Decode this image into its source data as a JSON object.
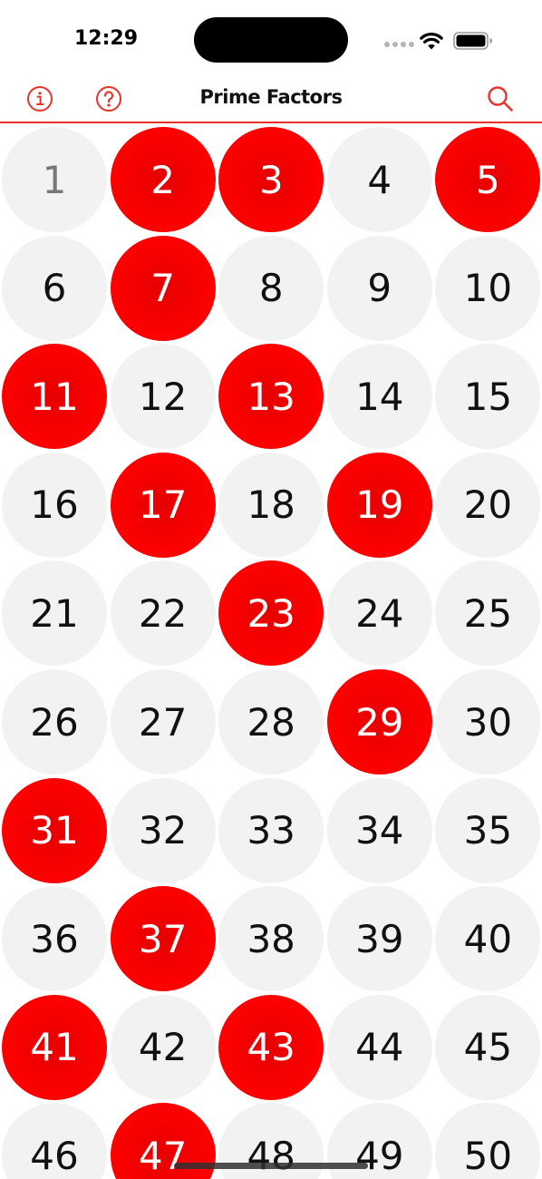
{
  "status_bar": {
    "time": "12:29"
  },
  "nav": {
    "title": "Prime Factors",
    "left_icons": [
      "info-icon",
      "help-icon"
    ],
    "right_icon": "search-icon"
  },
  "colors": {
    "accent": "#e8332a",
    "prime": "#ff0000",
    "composite_bg": "#f2f2f2",
    "unit_text": "#777777"
  },
  "grid": {
    "columns": 5,
    "cells": [
      {
        "label": "1",
        "kind": "unit"
      },
      {
        "label": "2",
        "kind": "prime"
      },
      {
        "label": "3",
        "kind": "prime"
      },
      {
        "label": "4",
        "kind": "composite"
      },
      {
        "label": "5",
        "kind": "prime"
      },
      {
        "label": "6",
        "kind": "composite"
      },
      {
        "label": "7",
        "kind": "prime"
      },
      {
        "label": "8",
        "kind": "composite"
      },
      {
        "label": "9",
        "kind": "composite"
      },
      {
        "label": "10",
        "kind": "composite"
      },
      {
        "label": "11",
        "kind": "prime"
      },
      {
        "label": "12",
        "kind": "composite"
      },
      {
        "label": "13",
        "kind": "prime"
      },
      {
        "label": "14",
        "kind": "composite"
      },
      {
        "label": "15",
        "kind": "composite"
      },
      {
        "label": "16",
        "kind": "composite"
      },
      {
        "label": "17",
        "kind": "prime"
      },
      {
        "label": "18",
        "kind": "composite"
      },
      {
        "label": "19",
        "kind": "prime"
      },
      {
        "label": "20",
        "kind": "composite"
      },
      {
        "label": "21",
        "kind": "composite"
      },
      {
        "label": "22",
        "kind": "composite"
      },
      {
        "label": "23",
        "kind": "prime"
      },
      {
        "label": "24",
        "kind": "composite"
      },
      {
        "label": "25",
        "kind": "composite"
      },
      {
        "label": "26",
        "kind": "composite"
      },
      {
        "label": "27",
        "kind": "composite"
      },
      {
        "label": "28",
        "kind": "composite"
      },
      {
        "label": "29",
        "kind": "prime"
      },
      {
        "label": "30",
        "kind": "composite"
      },
      {
        "label": "31",
        "kind": "prime"
      },
      {
        "label": "32",
        "kind": "composite"
      },
      {
        "label": "33",
        "kind": "composite"
      },
      {
        "label": "34",
        "kind": "composite"
      },
      {
        "label": "35",
        "kind": "composite"
      },
      {
        "label": "36",
        "kind": "composite"
      },
      {
        "label": "37",
        "kind": "prime"
      },
      {
        "label": "38",
        "kind": "composite"
      },
      {
        "label": "39",
        "kind": "composite"
      },
      {
        "label": "40",
        "kind": "composite"
      },
      {
        "label": "41",
        "kind": "prime"
      },
      {
        "label": "42",
        "kind": "composite"
      },
      {
        "label": "43",
        "kind": "prime"
      },
      {
        "label": "44",
        "kind": "composite"
      },
      {
        "label": "45",
        "kind": "composite"
      },
      {
        "label": "46",
        "kind": "composite"
      },
      {
        "label": "47",
        "kind": "prime"
      },
      {
        "label": "48",
        "kind": "composite"
      },
      {
        "label": "49",
        "kind": "composite"
      },
      {
        "label": "50",
        "kind": "composite"
      }
    ]
  }
}
